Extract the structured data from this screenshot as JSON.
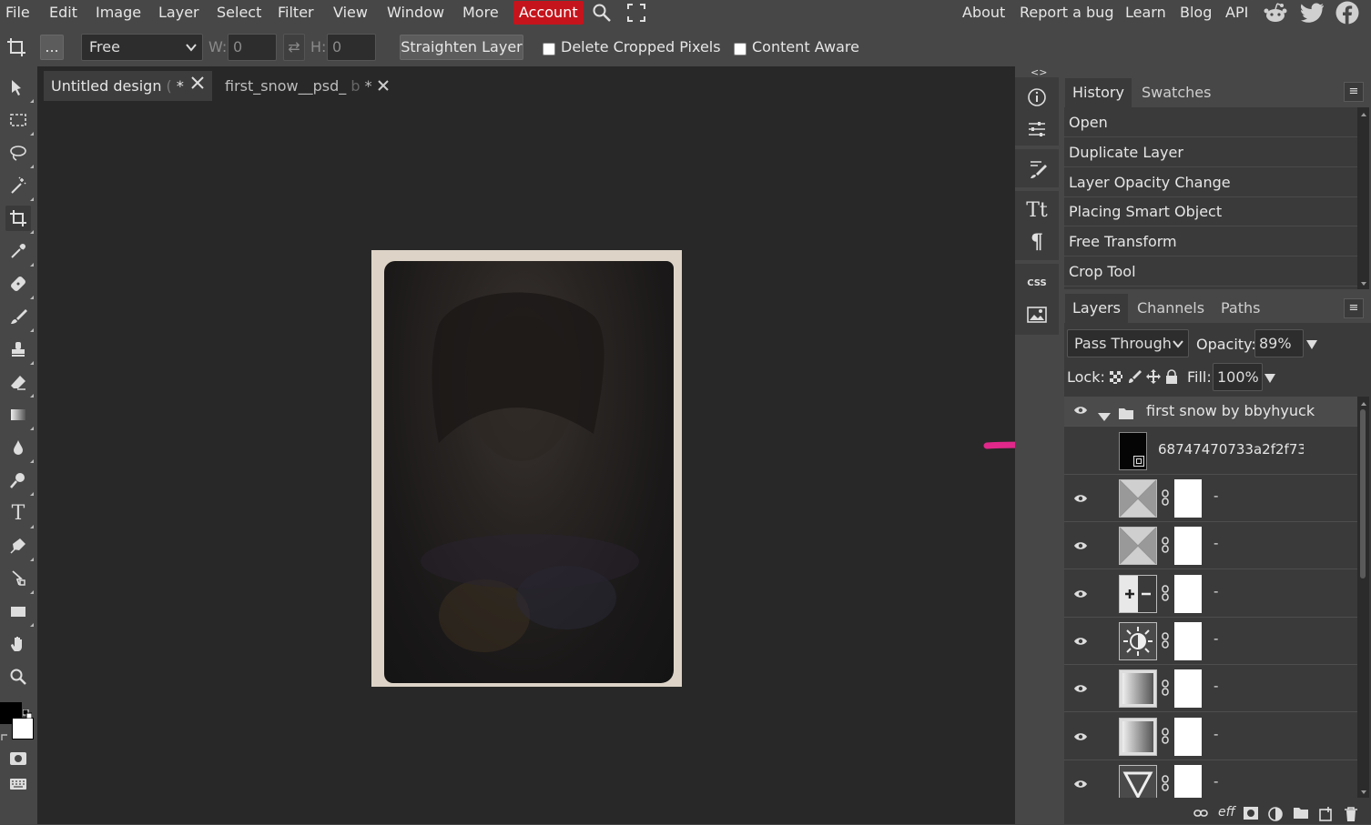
{
  "menubar": {
    "items": [
      "File",
      "Edit",
      "Image",
      "Layer",
      "Select",
      "Filter",
      "View",
      "Window",
      "More"
    ],
    "account": "Account",
    "right_links": [
      "About",
      "Report a bug",
      "Learn",
      "Blog",
      "API"
    ]
  },
  "options": {
    "more_label": "...",
    "mode_value": "Free",
    "w_label": "W:",
    "w_value": "0",
    "swap_icon": "⇄",
    "h_label": "H:",
    "h_value": "0",
    "straighten_label": "Straighten Layer",
    "delete_cropped_label": "Delete Cropped Pixels",
    "content_aware_label": "Content Aware"
  },
  "tabs": [
    {
      "name": "Untitled design",
      "suffix": "(",
      "dirty": "*"
    },
    {
      "name": "first_snow__psd_",
      "suffix": "b",
      "dirty": "*"
    }
  ],
  "mid_toggles": {
    "left": "<>",
    "right": "><"
  },
  "history_panel": {
    "tabs": [
      "History",
      "Swatches"
    ],
    "items": [
      "Open",
      "Duplicate Layer",
      "Layer Opacity Change",
      "Placing Smart Object",
      "Free Transform",
      "Crop Tool"
    ]
  },
  "layers_panel": {
    "tabs": [
      "Layers",
      "Channels",
      "Paths"
    ],
    "blend_mode": "Pass Through",
    "opacity_label": "Opacity:",
    "opacity_value": "89%",
    "lock_label": "Lock:",
    "fill_label": "Fill:",
    "fill_value": "100%",
    "group_name": "first snow by bbyhyuck",
    "smart_object_name": "68747470733a2f2f73",
    "layers": [
      {
        "thumb_icon": "x-icon",
        "name": "-"
      },
      {
        "thumb_icon": "x-icon",
        "name": "-"
      },
      {
        "thumb_icon": "plus-minus-icon",
        "name": "-"
      },
      {
        "thumb_icon": "sun-icon",
        "name": "-"
      },
      {
        "thumb_icon": "gradient-icon",
        "name": "-"
      },
      {
        "thumb_icon": "gradient-icon",
        "name": "-"
      },
      {
        "thumb_icon": "triangle-icon",
        "name": "-"
      }
    ],
    "bottom_icons": [
      "link-icon",
      "eff",
      "mask-icon",
      "adjustment-icon",
      "folder-icon",
      "new-layer-icon",
      "trash-icon"
    ]
  },
  "colors": {
    "accent_account": "#c5141c",
    "annotation_arrow": "#e0288a",
    "panel_bg": "#474747",
    "workspace_bg": "#282828"
  }
}
